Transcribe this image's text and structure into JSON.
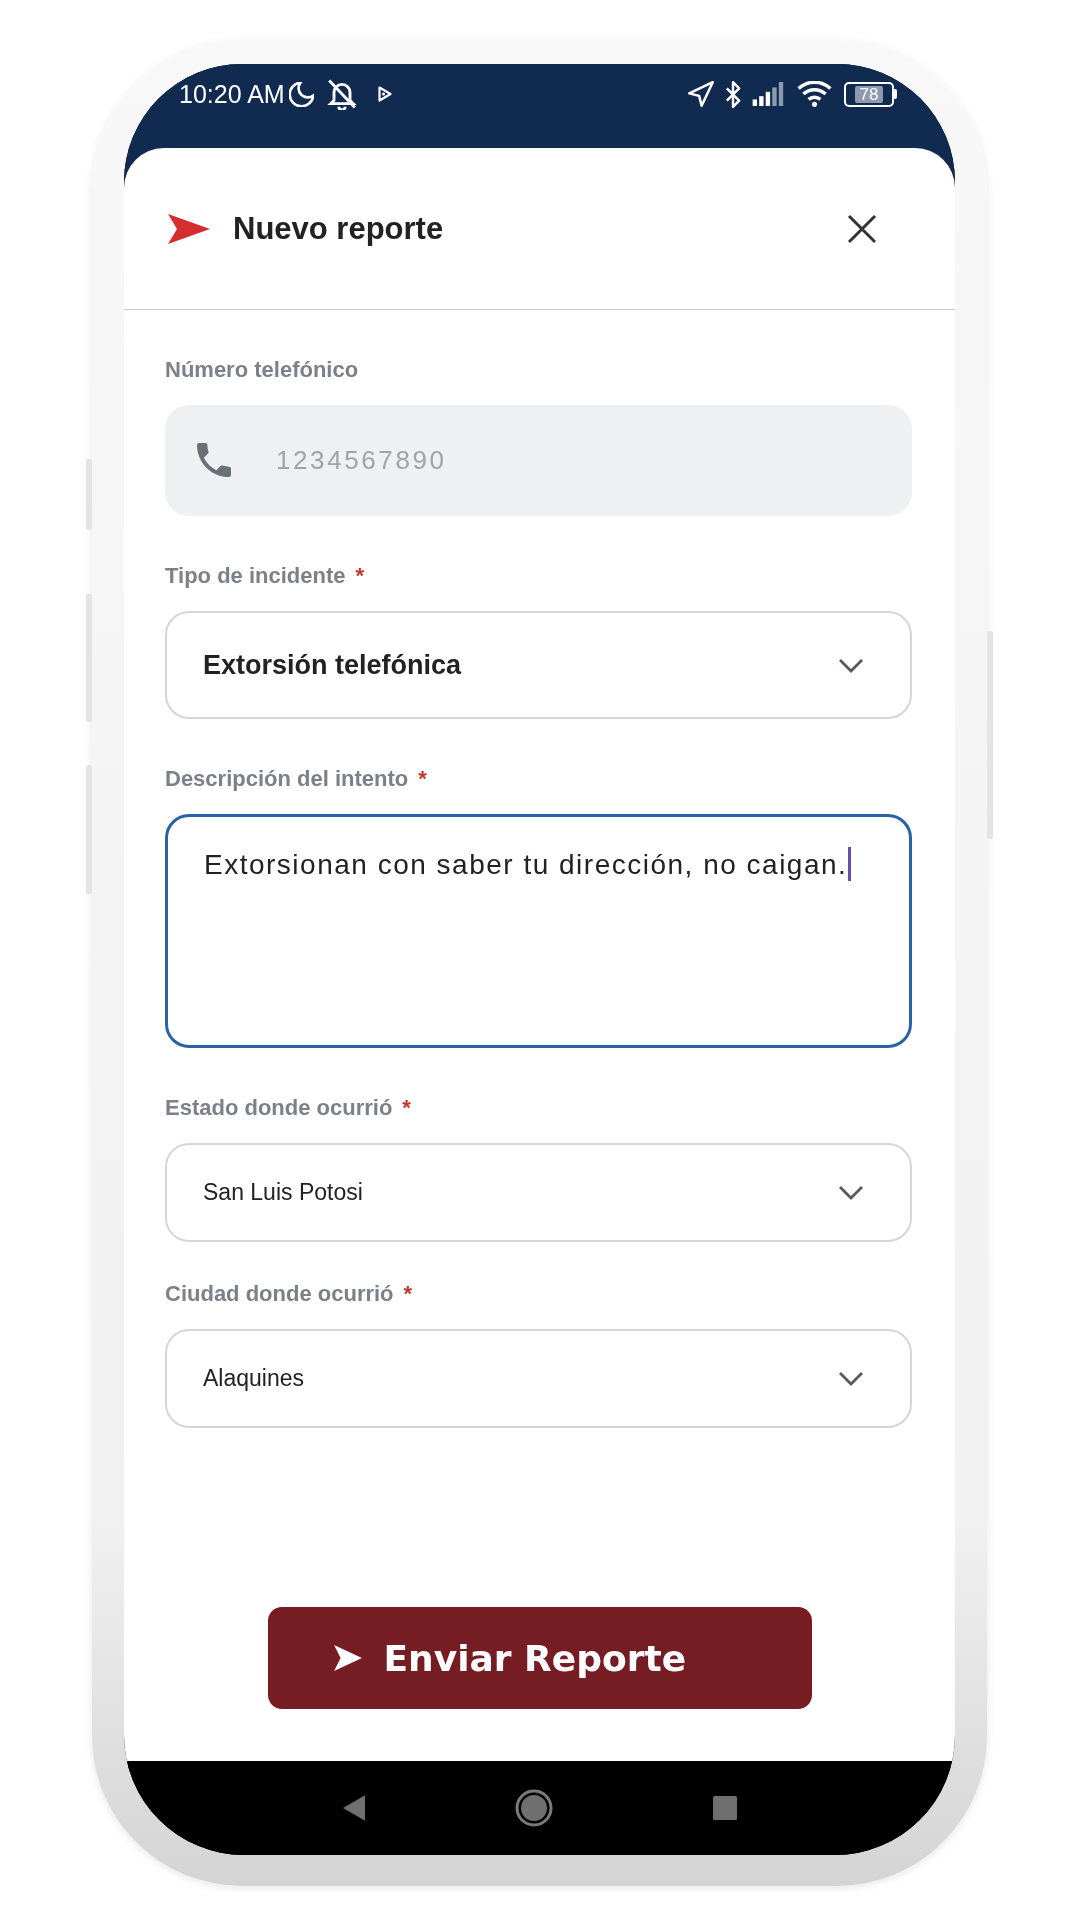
{
  "status_bar": {
    "time": "10:20 AM",
    "battery": "78"
  },
  "header": {
    "title": "Nuevo reporte"
  },
  "fields": [
    {
      "kind": "phone",
      "label": "Número telefónico",
      "placeholder": "1234567890",
      "focused": false
    },
    {
      "kind": "picker",
      "label": "Tipo de incidente",
      "required_mark": "*",
      "value": "Extorsión telefónica",
      "focused": false
    },
    {
      "kind": "textarea",
      "label": "Descripción del intento",
      "required_mark": "*",
      "value": "Extorsionan con saber tu dirección, no caigan.",
      "focused": true
    },
    {
      "kind": "select",
      "label": "Estado donde ocurrió",
      "required_mark": "*",
      "value": "San Luis Potosi",
      "focused": false
    },
    {
      "kind": "select",
      "label": "Ciudad donde ocurrió",
      "required_mark": "*",
      "value": "Alaquines",
      "focused": false
    }
  ],
  "submit_button": {
    "label": "Enviar Reporte"
  }
}
